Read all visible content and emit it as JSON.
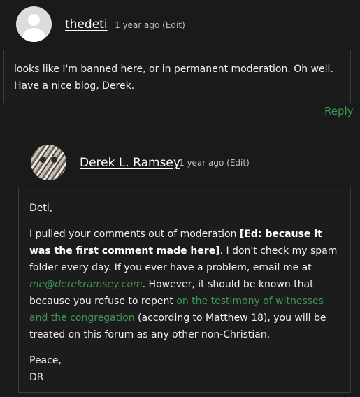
{
  "comment1": {
    "author": "thedeti",
    "meta": "1 year ago (Edit)",
    "lines": [
      "looks like I'm banned here, or in permanent moderation. Oh well.",
      "Have a nice blog, Derek."
    ],
    "reply_label": "Reply"
  },
  "comment2": {
    "author": "Derek L. Ramsey",
    "meta": "1 year ago (Edit)",
    "greeting": "Deti,",
    "body": {
      "part1": "I pulled your comments out of moderation ",
      "bold": "[Ed: because it was the first comment made here]",
      "part2": ". I don't check my spam folder every day. If you ever have a problem, email me at ",
      "email": "me@derekramsey.com",
      "part3": ". However, it should be known that because you refuse to repent ",
      "link": "on the testimony of witnesses and the congregation",
      "part4": " (according to Matthew 18), you will be treated on this forum as any other non-Christian."
    },
    "signoff": "Peace,",
    "signature": "DR"
  },
  "colors": {
    "background": "#1a1a1a",
    "link_green": "#3d9a4e",
    "border": "#3c3c3c"
  }
}
